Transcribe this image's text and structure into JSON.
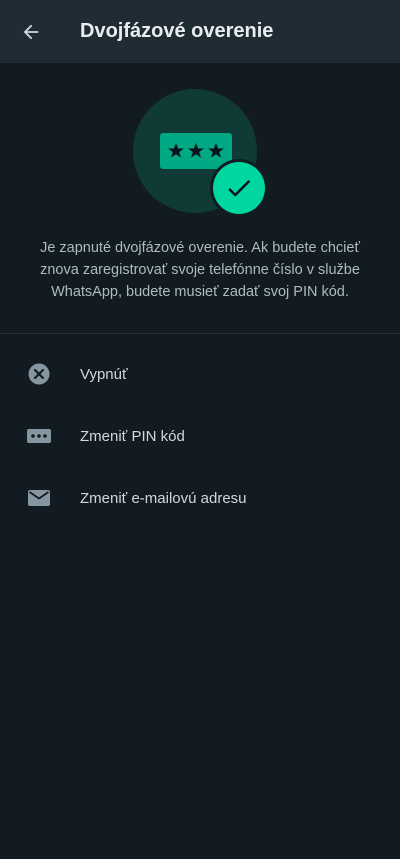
{
  "header": {
    "title": "Dvojfázové overenie",
    "back_icon": "arrow-left-icon"
  },
  "hero": {
    "pin_mask": "***",
    "icons": [
      "pin-box-icon",
      "check-icon"
    ]
  },
  "description": "Je zapnuté dvojfázové overenie. Ak budete chcieť znova zaregistrovať svoje telefónne číslo v službe WhatsApp, budete musieť zadať svoj PIN kód.",
  "menu": {
    "items": [
      {
        "label": "Vypnúť",
        "icon": "close-circle-icon"
      },
      {
        "label": "Zmeniť PIN kód",
        "icon": "pin-dots-icon"
      },
      {
        "label": "Zmeniť e-mailovú adresu",
        "icon": "mail-icon"
      }
    ]
  },
  "colors": {
    "background": "#111b21",
    "appbar": "#1f2c34",
    "accent": "#00a884",
    "check": "#00d7a0",
    "icon": "#8696a0",
    "text_secondary": "#aebac1"
  }
}
